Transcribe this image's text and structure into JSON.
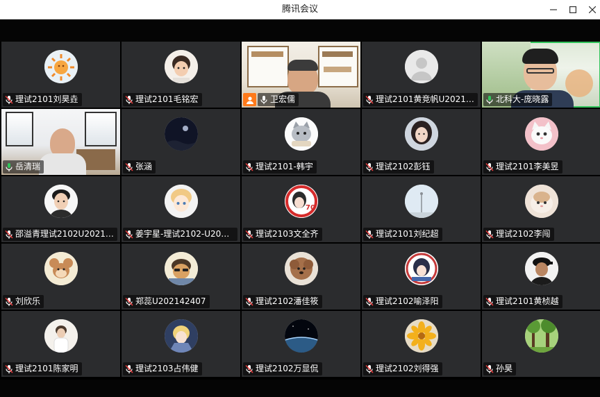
{
  "window": {
    "title": "腾讯会议"
  },
  "participants": [
    {
      "name": "理试2101刘昊垚",
      "mic": "muted",
      "avatar": "sun-icon"
    },
    {
      "name": "理试2101毛铭宏",
      "mic": "muted",
      "avatar": "child-photo-icon"
    },
    {
      "name": "卫宏儒",
      "mic": "on",
      "avatar": "video",
      "host": true
    },
    {
      "name": "理试2101黄竞帆U2021…",
      "mic": "muted",
      "avatar": "default-user-icon"
    },
    {
      "name": "北科大-庞晓露",
      "mic": "active",
      "avatar": "video"
    },
    {
      "name": "岳清瑞",
      "mic": "active",
      "avatar": "video"
    },
    {
      "name": "张涵",
      "mic": "muted",
      "avatar": "night-sky-icon"
    },
    {
      "name": "理试2101-韩宇",
      "mic": "muted",
      "avatar": "cat-cartoon-icon"
    },
    {
      "name": "理试2102彭钰",
      "mic": "muted",
      "avatar": "woman-photo-icon"
    },
    {
      "name": "理试2101李美昱",
      "mic": "muted",
      "avatar": "white-cat-icon"
    },
    {
      "name": "邵溢青理试2102U2021…",
      "mic": "muted",
      "avatar": "man-photo-icon"
    },
    {
      "name": "姜宇星-理试2102-U202…",
      "mic": "muted",
      "avatar": "anime-boy-icon"
    },
    {
      "name": "理试2103文全齐",
      "mic": "muted",
      "avatar": "anime-70-icon"
    },
    {
      "name": "理试2101刘纪超",
      "mic": "muted",
      "avatar": "sky-photo-icon"
    },
    {
      "name": "理试2102李闯",
      "mic": "muted",
      "avatar": "cat-photo-icon"
    },
    {
      "name": "刘欣乐",
      "mic": "muted",
      "avatar": "cartoon-mouse-icon"
    },
    {
      "name": "郑蕊U202142407",
      "mic": "muted",
      "avatar": "cartoon-bear-icon"
    },
    {
      "name": "理试2102潘佳筱",
      "mic": "muted",
      "avatar": "poodle-icon"
    },
    {
      "name": "理试2102喻泽阳",
      "mic": "muted",
      "avatar": "anime-girl-icon"
    },
    {
      "name": "理试2101黄桢越",
      "mic": "muted",
      "avatar": "man-cap-icon"
    },
    {
      "name": "理试2101陈家明",
      "mic": "muted",
      "avatar": "person-white-icon"
    },
    {
      "name": "理试2103占伟健",
      "mic": "muted",
      "avatar": "anime-knight-icon"
    },
    {
      "name": "理试2102万显侃",
      "mic": "muted",
      "avatar": "planet-icon"
    },
    {
      "name": "理试2102刘得强",
      "mic": "muted",
      "avatar": "yellow-flower-icon"
    },
    {
      "name": "孙昊",
      "mic": "muted",
      "avatar": "forest-icon"
    }
  ],
  "colors": {
    "tile": "#2b2c2e",
    "mic_muted": "#e23b3b",
    "mic_active": "#31c45b",
    "host": "#ff7a1a"
  }
}
